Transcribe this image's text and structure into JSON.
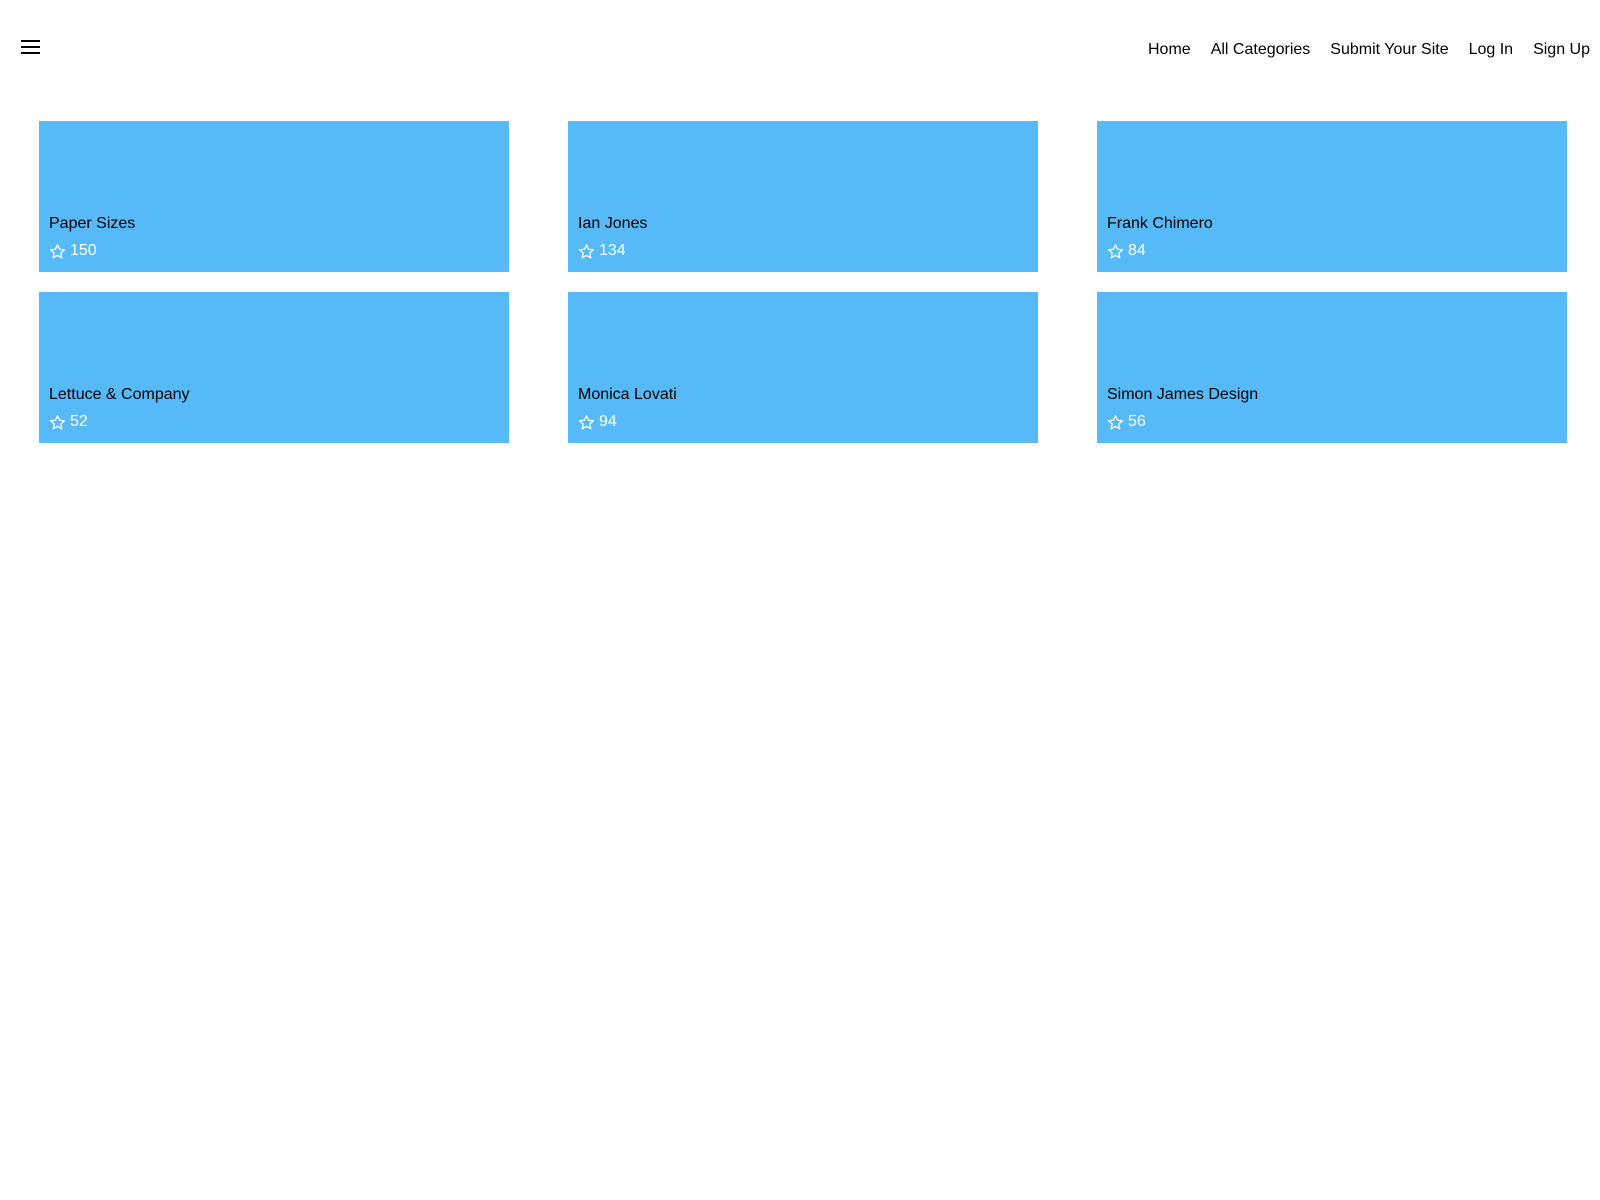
{
  "header": {
    "menu_icon": "hamburger-menu-icon",
    "nav": [
      {
        "label": "Home"
      },
      {
        "label": "All Categories"
      },
      {
        "label": "Submit Your Site"
      },
      {
        "label": "Log In"
      },
      {
        "label": "Sign Up"
      }
    ]
  },
  "cards": [
    {
      "title": "Paper Sizes",
      "stars": "150",
      "icon": "star-outline-icon"
    },
    {
      "title": "Ian Jones",
      "stars": "134",
      "icon": "star-outline-icon"
    },
    {
      "title": "Frank Chimero",
      "stars": "84",
      "icon": "star-outline-icon"
    },
    {
      "title": "Lettuce & Company",
      "stars": "52",
      "icon": "star-outline-icon"
    },
    {
      "title": "Monica Lovati",
      "stars": "94",
      "icon": "star-outline-icon"
    },
    {
      "title": "Simon James Design",
      "stars": "56",
      "icon": "star-outline-icon"
    }
  ],
  "colors": {
    "card_background": "#55baf7",
    "star_text": "#ffffff",
    "title_text": "#000000"
  }
}
